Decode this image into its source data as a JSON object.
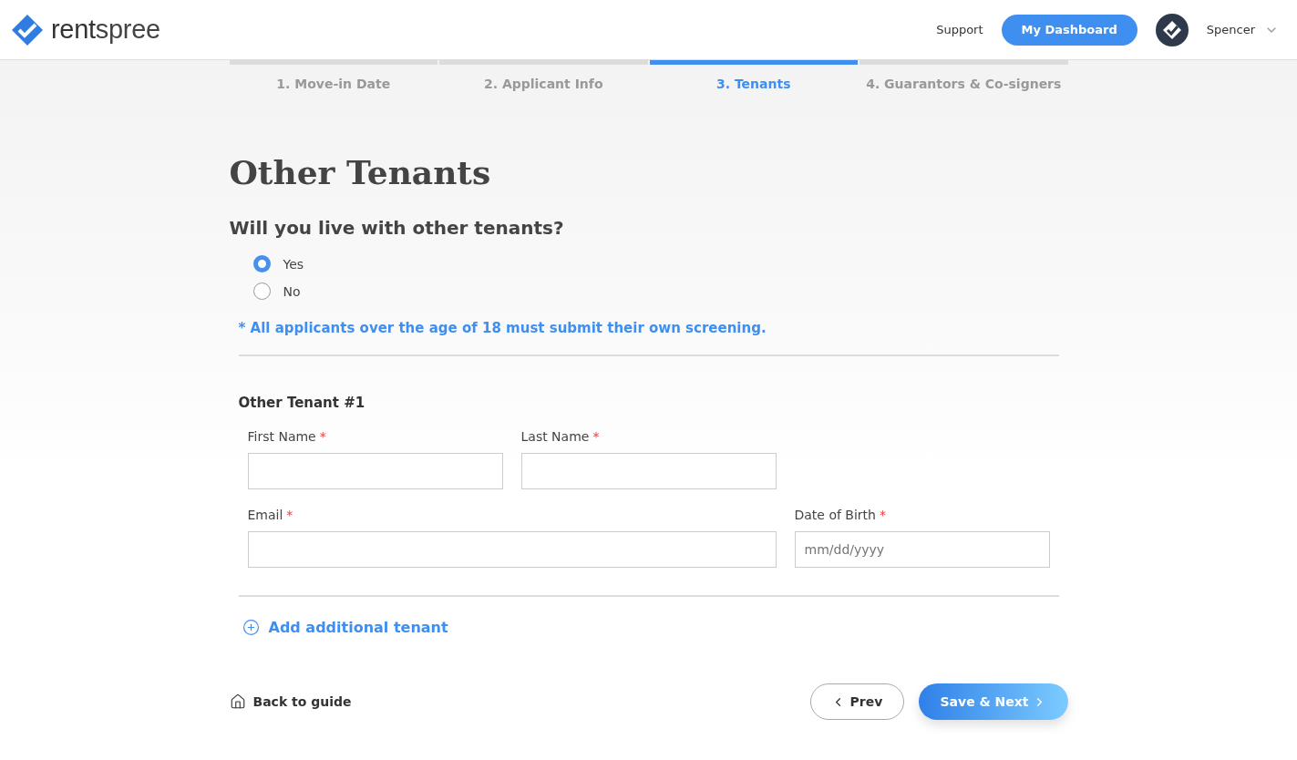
{
  "header": {
    "logo": "**rent**spree",
    "links": [
      {
        "label": "Support",
        "kind": "link"
      },
      {
        "label": "My Dashboard",
        "kind": "button"
      }
    ],
    "user": {
      "name": "Spencer"
    }
  },
  "steps": [
    {
      "label": "1. Move-in Date",
      "selected": false
    },
    {
      "label": "2. Applicant Info",
      "selected": false
    },
    {
      "label": "3. Tenants",
      "selected": true
    },
    {
      "label": "4. Guarantors & Co-signers",
      "selected": false
    }
  ],
  "title": "Other Tenants",
  "question": "Will you live with other tenants?",
  "options": [
    {
      "label": "Yes",
      "selected": true
    },
    {
      "label": "No",
      "selected": false
    }
  ],
  "note": "* All applicants over the age of 18 must submit their own screening.",
  "tenant": {
    "heading": "Other Tenant #1",
    "fields": [
      {
        "label": "First Name",
        "required_mark": "*",
        "kind": "half"
      },
      {
        "label": "Last Name",
        "required_mark": "*",
        "kind": "half"
      },
      {
        "label": "Email",
        "required_mark": "*",
        "kind": "wide"
      },
      {
        "label": "Date of Birth",
        "required_mark": "*",
        "kind": "half",
        "placeholder": "mm/dd/yyyy"
      }
    ]
  },
  "add_button": "Add additional tenant",
  "footer": {
    "back": "Back to guide",
    "prev": "Prev",
    "next": "Save & Next"
  }
}
